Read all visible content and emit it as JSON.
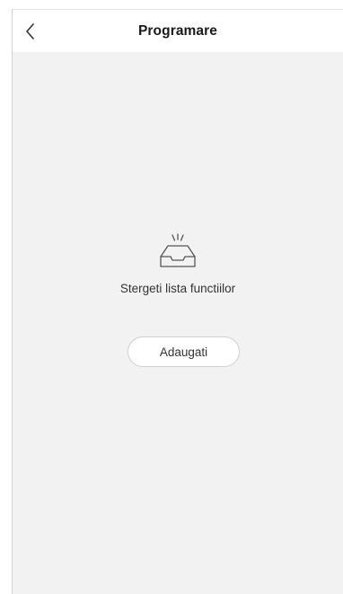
{
  "header": {
    "title": "Programare",
    "back_icon": "chevron-left-icon"
  },
  "empty_state": {
    "icon": "empty-inbox-icon",
    "message": "Stergeti lista functiilor",
    "add_button_label": "Adaugati"
  }
}
